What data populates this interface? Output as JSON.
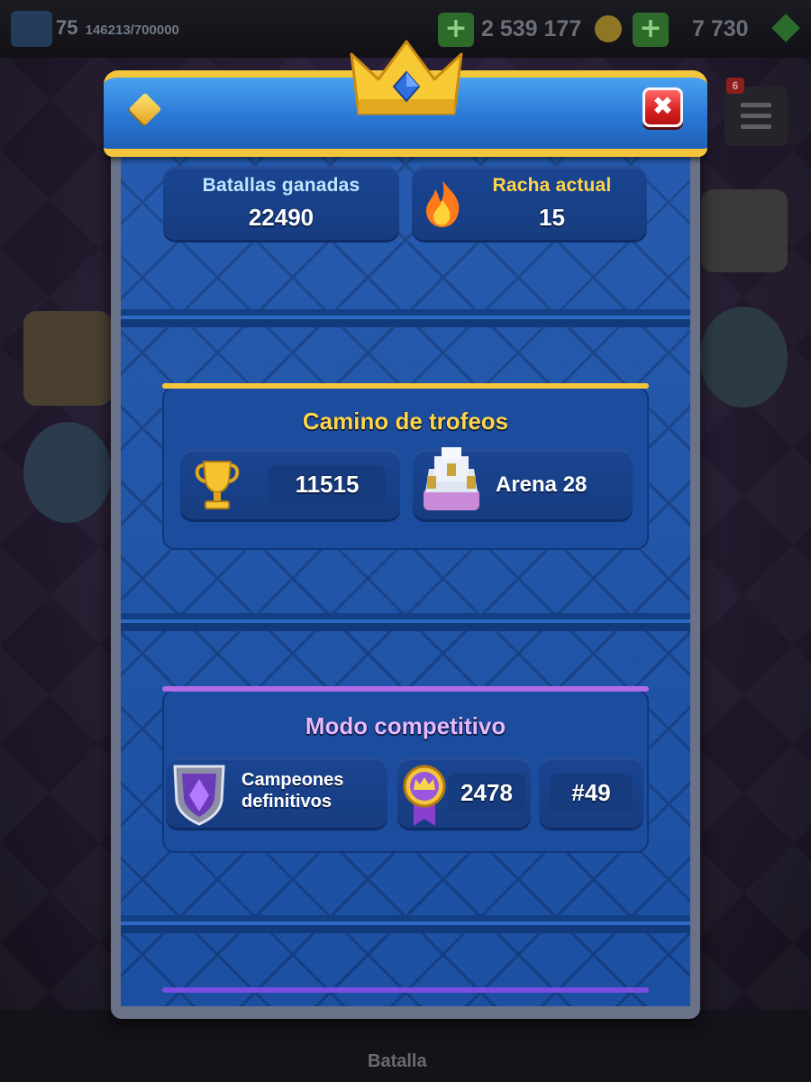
{
  "top_bar": {
    "level": "75",
    "xp": "146213/700000",
    "gold": "2 539 177",
    "gems": "7 730",
    "menu_badge": "6"
  },
  "bottom_nav": {
    "battle_label": "Batalla"
  },
  "modal": {
    "close_glyph": "✖",
    "stats": {
      "battles_won_label": "Batallas ganadas",
      "battles_won_value": "22490",
      "current_streak_label": "Racha actual",
      "current_streak_value": "15"
    },
    "trophy_road": {
      "title": "Camino de trofeos",
      "trophies": "11515",
      "arena": "Arena 28"
    },
    "competitive": {
      "title": "Modo competitivo",
      "league_line1": "Campeones",
      "league_line2": "definitivos",
      "rating": "2478",
      "rank": "#49"
    }
  },
  "colors": {
    "gold_accent": "#f2c53a",
    "purple_accent": "#b06ce8",
    "panel_blue": "#1d54ab",
    "label_cyan": "#bfe6ff",
    "label_yellow": "#ffd54a"
  }
}
